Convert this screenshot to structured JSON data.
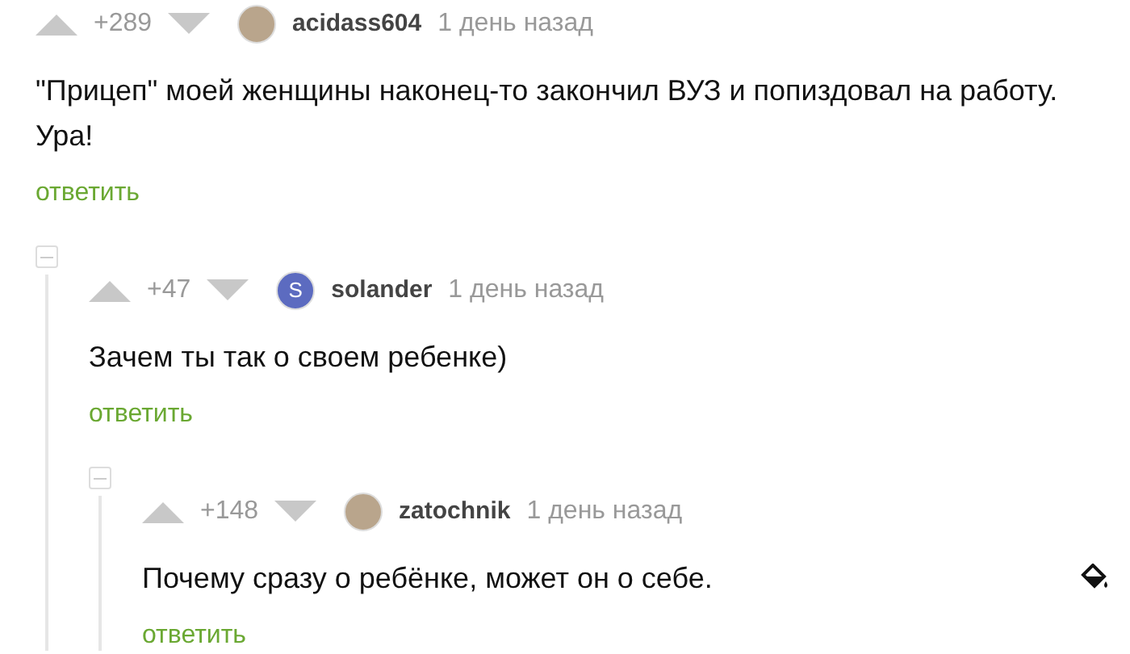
{
  "comments": [
    {
      "rating": "+289",
      "author": "acidass604",
      "avatar": {
        "kind": "photo"
      },
      "time": "1 день назад",
      "text": "\"Прицеп\" моей женщины наконец-то закончил ВУЗ и попиздовал на работу. Ура!",
      "reply": "ответить",
      "children": [
        {
          "rating": "+47",
          "author": "solander",
          "avatar": {
            "kind": "letter",
            "letter": "S",
            "color": "#5c6bc0"
          },
          "time": "1 день назад",
          "text": "Зачем ты так о своем ребенке)",
          "reply": "ответить",
          "children": [
            {
              "rating": "+148",
              "author": "zatochnik",
              "avatar": {
                "kind": "photo"
              },
              "time": "1 день назад",
              "text": "Почему сразу о ребёнке, может он о себе.",
              "reply": "ответить",
              "show_paint_icon": true
            }
          ]
        }
      ]
    }
  ]
}
